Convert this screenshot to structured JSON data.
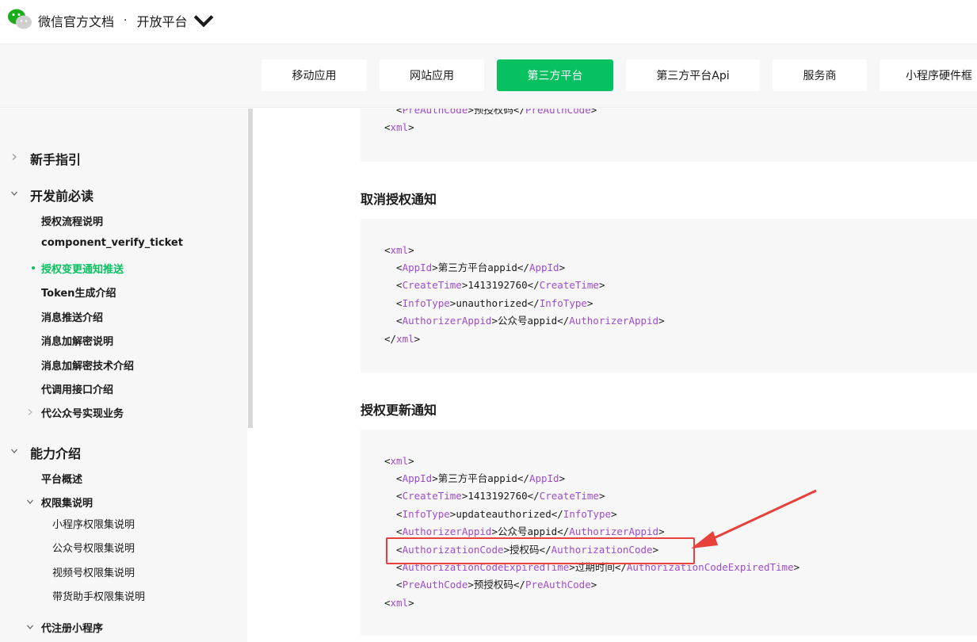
{
  "header": {
    "title": "微信官方文档",
    "separator": "·",
    "platform": "开放平台",
    "logo_icon": "wechat-logo-icon",
    "dropdown_icon": "chevron-down-icon"
  },
  "tabs": [
    {
      "label": "移动应用",
      "active": false
    },
    {
      "label": "网站应用",
      "active": false
    },
    {
      "label": "第三方平台",
      "active": true
    },
    {
      "label": "第三方平台Api",
      "active": false
    },
    {
      "label": "服务商",
      "active": false
    },
    {
      "label": "小程序硬件框"
    }
  ],
  "sidebar": {
    "sections": [
      {
        "label": "新手指引",
        "expanded": false
      },
      {
        "label": "开发前必读",
        "expanded": true
      },
      {
        "label": "能力介绍",
        "expanded": true
      }
    ],
    "items": [
      "授权流程说明",
      "component_verify_ticket",
      "授权变更通知推送",
      "Token生成介绍",
      "消息推送介绍",
      "消息加解密说明",
      "消息加解密技术介绍",
      "代调用接口介绍",
      "代公众号实现业务",
      "平台概述",
      "权限集说明",
      "小程序权限集说明",
      "公众号权限集说明",
      "视频号权限集说明",
      "带货助手权限集说明",
      "代注册小程序"
    ]
  },
  "content": {
    "block0": {
      "lines": [
        [
          "  <",
          "PreAuthCode",
          ">预授权码</",
          "PreAuthCode",
          ">"
        ],
        [
          "<",
          "xml",
          ">"
        ]
      ]
    },
    "heading1": "取消授权通知",
    "block1": {
      "lines": [
        [
          "<",
          "xml",
          ">"
        ],
        [
          "  <",
          "AppId",
          ">第三方平台appid</",
          "AppId",
          ">"
        ],
        [
          "  <",
          "CreateTime",
          ">1413192760</",
          "CreateTime",
          ">"
        ],
        [
          "  <",
          "InfoType",
          ">unauthorized</",
          "InfoType",
          ">"
        ],
        [
          "  <",
          "AuthorizerAppid",
          ">公众号appid</",
          "AuthorizerAppid",
          ">"
        ],
        [
          "</",
          "xml",
          ">"
        ]
      ]
    },
    "heading2": "授权更新通知",
    "block2": {
      "lines": [
        [
          "<",
          "xml",
          ">"
        ],
        [
          "  <",
          "AppId",
          ">第三方平台appid</",
          "AppId",
          ">"
        ],
        [
          "  <",
          "CreateTime",
          ">1413192760</",
          "CreateTime",
          ">"
        ],
        [
          "  <",
          "InfoType",
          ">updateauthorized</",
          "InfoType",
          ">"
        ],
        [
          "  <",
          "AuthorizerAppid",
          ">公众号appid</",
          "AuthorizerAppid",
          ">"
        ],
        [
          "  <",
          "AuthorizationCode",
          ">授权码</",
          "AuthorizationCode",
          ">"
        ],
        [
          "  <",
          "AuthorizationCodeExpiredTime",
          ">过期时间</",
          "AuthorizationCodeExpiredTime",
          ">"
        ],
        [
          "  <",
          "PreAuthCode",
          ">预授权码</",
          "PreAuthCode",
          ">"
        ],
        [
          "<",
          "xml",
          ">"
        ]
      ]
    }
  },
  "colors": {
    "accent": "#07c160",
    "xml_tag": "#a04bd0",
    "annotation": "#e8403a"
  }
}
